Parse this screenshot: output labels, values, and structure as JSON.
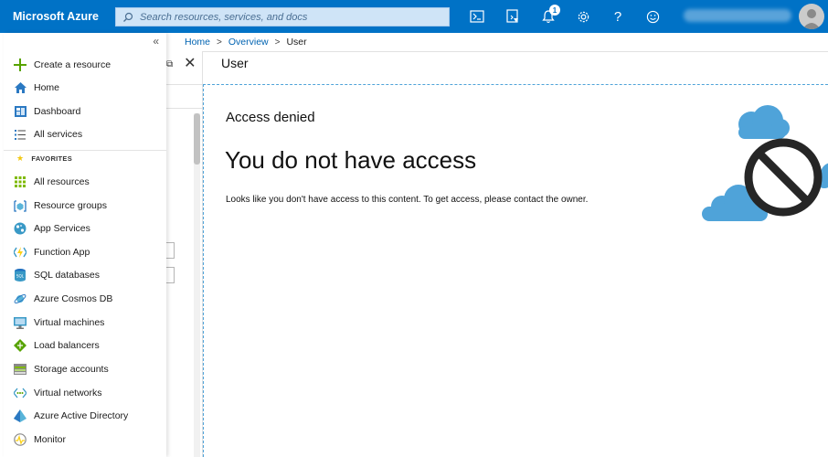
{
  "header": {
    "brand": "Microsoft Azure",
    "search_placeholder": "Search resources, services, and docs",
    "notification_count": "1",
    "icons": [
      "cloud-shell-icon",
      "directory-filter-icon",
      "bell-icon",
      "gear-icon",
      "help-icon",
      "smiley-icon",
      "avatar-icon"
    ]
  },
  "sidebar": {
    "collapse_glyph": "«",
    "top_items": [
      {
        "label": "Create a resource",
        "icon": "plus-icon"
      },
      {
        "label": "Home",
        "icon": "home-icon"
      },
      {
        "label": "Dashboard",
        "icon": "dashboard-icon"
      },
      {
        "label": "All services",
        "icon": "list-icon"
      }
    ],
    "favorites_header": "FAVORITES",
    "favorites": [
      {
        "label": "All resources",
        "icon": "grid-icon"
      },
      {
        "label": "Resource groups",
        "icon": "resource-groups-icon"
      },
      {
        "label": "App Services",
        "icon": "app-services-icon"
      },
      {
        "label": "Function App",
        "icon": "function-app-icon"
      },
      {
        "label": "SQL databases",
        "icon": "sql-icon"
      },
      {
        "label": "Azure Cosmos DB",
        "icon": "cosmos-icon"
      },
      {
        "label": "Virtual machines",
        "icon": "vm-icon"
      },
      {
        "label": "Load balancers",
        "icon": "load-balancer-icon"
      },
      {
        "label": "Storage accounts",
        "icon": "storage-icon"
      },
      {
        "label": "Virtual networks",
        "icon": "vnet-icon"
      },
      {
        "label": "Azure Active Directory",
        "icon": "aad-icon"
      },
      {
        "label": "Monitor",
        "icon": "monitor-icon"
      }
    ]
  },
  "breadcrumb": {
    "home": "Home",
    "overview": "Overview",
    "current": "User",
    "separator": ">"
  },
  "blade": {
    "title": "User",
    "access_denied_label": "Access denied",
    "main_message": "You do not have access",
    "description": "Looks like you don't have access to this content. To get access, please contact the owner."
  },
  "colors": {
    "topbar": "#0072c6",
    "link": "#0063b1",
    "cloud": "#4fa3d9"
  }
}
